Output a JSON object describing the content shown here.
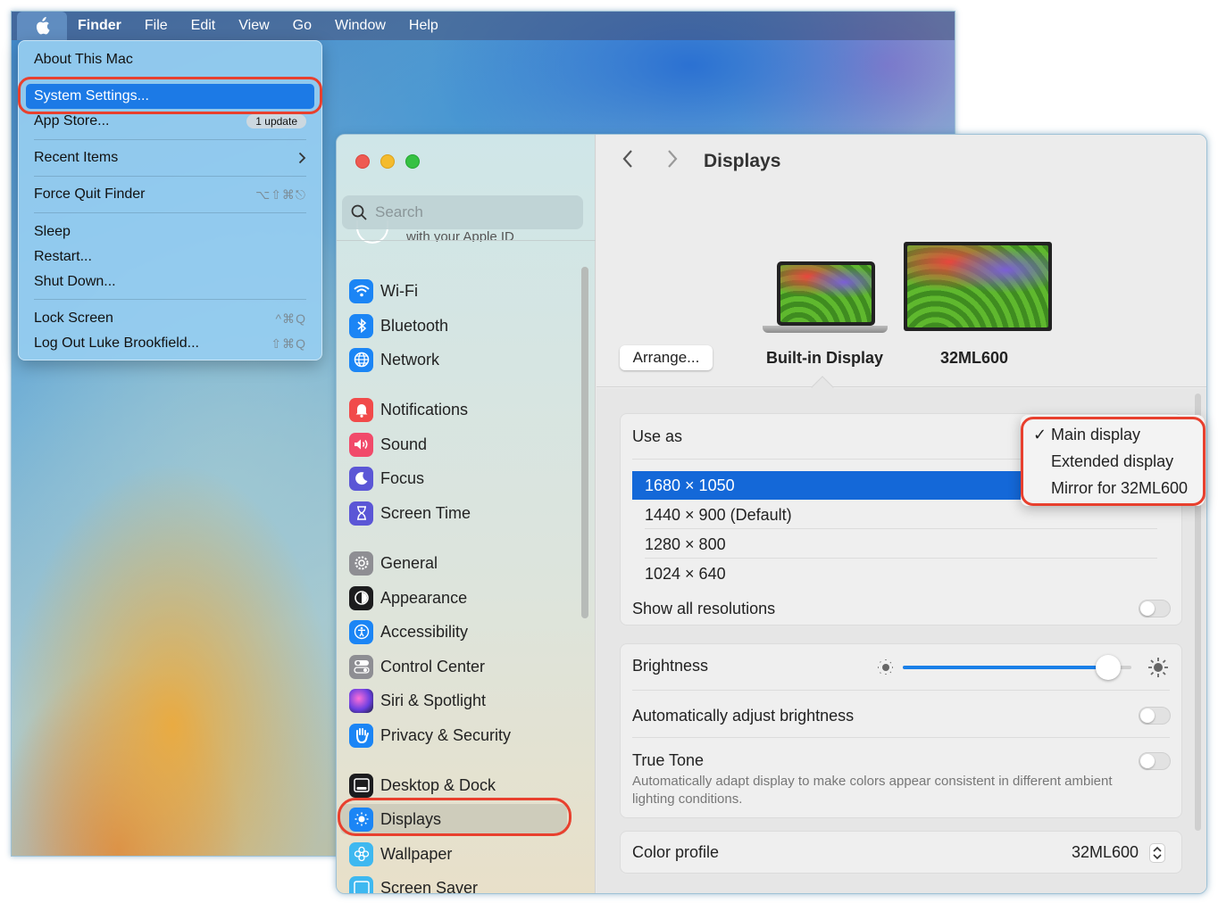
{
  "menubar": {
    "apple_icon": "apple-logo-icon",
    "items": [
      "Finder",
      "File",
      "Edit",
      "View",
      "Go",
      "Window",
      "Help"
    ]
  },
  "apple_menu": {
    "about": "About This Mac",
    "system_settings": "System Settings...",
    "app_store": "App Store...",
    "app_store_badge": "1 update",
    "recent_items": "Recent Items",
    "force_quit": "Force Quit Finder",
    "force_quit_shortcut": "⌥⇧⌘⎋",
    "sleep": "Sleep",
    "restart": "Restart...",
    "shut_down": "Shut Down...",
    "lock_screen": "Lock Screen",
    "lock_screen_shortcut": "^⌘Q",
    "log_out": "Log Out Luke Brookfield...",
    "log_out_shortcut": "⇧⌘Q"
  },
  "settings": {
    "search_placeholder": "Search",
    "apple_id_peek": "with your Apple ID",
    "sidebar": {
      "wifi": "Wi-Fi",
      "bluetooth": "Bluetooth",
      "network": "Network",
      "notifications": "Notifications",
      "sound": "Sound",
      "focus": "Focus",
      "screen_time": "Screen Time",
      "general": "General",
      "appearance": "Appearance",
      "accessibility": "Accessibility",
      "control_center": "Control Center",
      "siri": "Siri & Spotlight",
      "privacy": "Privacy & Security",
      "desktop_dock": "Desktop & Dock",
      "displays": "Displays",
      "wallpaper": "Wallpaper",
      "screen_saver": "Screen Saver"
    },
    "title": "Displays",
    "arrange": "Arrange...",
    "display_builtin": "Built-in Display",
    "display_external": "32ML600",
    "use_as": "Use as",
    "resolutions": [
      "1680 × 1050",
      "1440 × 900 (Default)",
      "1280 × 800",
      "1024 × 640"
    ],
    "show_all_resolutions": "Show all resolutions",
    "brightness": "Brightness",
    "brightness_level": 0.9,
    "auto_brightness": "Automatically adjust brightness",
    "true_tone": "True Tone",
    "true_tone_desc": "Automatically adapt display to make colors appear consistent in different ambient lighting conditions.",
    "color_profile": "Color profile",
    "color_profile_value": "32ML600",
    "use_as_options": {
      "main": "Main display",
      "check": "✓",
      "extended": "Extended display",
      "mirror": "Mirror for 32ML600"
    }
  },
  "colors": {
    "accent": "#1468d8",
    "annotation": "#e8402e"
  }
}
